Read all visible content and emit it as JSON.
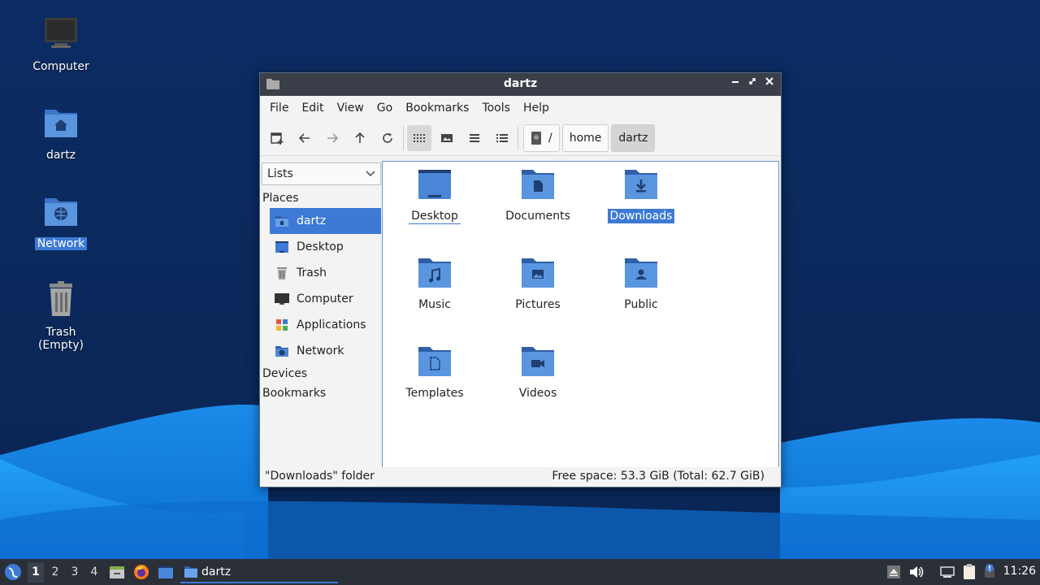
{
  "desktop": {
    "icons": [
      {
        "label": "Computer",
        "icon": "computer-icon"
      },
      {
        "label": "dartz",
        "icon": "home-folder-icon"
      },
      {
        "label": "Network",
        "icon": "network-folder-icon",
        "selected": true
      },
      {
        "label": "Trash (Empty)",
        "icon": "trash-icon"
      }
    ]
  },
  "window": {
    "title": "dartz",
    "menu": [
      "File",
      "Edit",
      "View",
      "Go",
      "Bookmarks",
      "Tools",
      "Help"
    ],
    "toolbar": {
      "buttons": [
        "new-tab-icon",
        "back-icon",
        "forward-icon",
        "up-icon",
        "reload-icon",
        "icon-view-icon",
        "thumbnail-view-icon",
        "compact-view-icon",
        "detailed-list-view-icon"
      ]
    },
    "breadcrumbs": [
      "/",
      "home",
      "dartz"
    ],
    "sidepane": {
      "mode": "Lists",
      "places_header": "Places",
      "places": [
        {
          "label": "dartz",
          "icon": "home-icon",
          "selected": true
        },
        {
          "label": "Desktop",
          "icon": "desktop-icon"
        },
        {
          "label": "Trash",
          "icon": "trash-icon"
        },
        {
          "label": "Computer",
          "icon": "computer-icon"
        },
        {
          "label": "Applications",
          "icon": "applications-icon"
        },
        {
          "label": "Network",
          "icon": "network-icon"
        }
      ],
      "devices_header": "Devices",
      "bookmarks_header": "Bookmarks"
    },
    "files": [
      {
        "label": "Desktop",
        "icon": "desktop-folder-icon"
      },
      {
        "label": "Documents",
        "icon": "documents-folder-icon"
      },
      {
        "label": "Downloads",
        "icon": "downloads-folder-icon",
        "selected": true
      },
      {
        "label": "Music",
        "icon": "music-folder-icon"
      },
      {
        "label": "Pictures",
        "icon": "pictures-folder-icon"
      },
      {
        "label": "Public",
        "icon": "public-folder-icon"
      },
      {
        "label": "Templates",
        "icon": "templates-folder-icon"
      },
      {
        "label": "Videos",
        "icon": "videos-folder-icon"
      }
    ],
    "status": {
      "left": "\"Downloads\" folder",
      "right": "Free space: 53.3 GiB (Total: 62.7 GiB)"
    }
  },
  "taskbar": {
    "workspaces": [
      "1",
      "2",
      "3",
      "4"
    ],
    "current_workspace": "1",
    "task_label": "dartz",
    "clock": "11:26"
  },
  "colors": {
    "accent": "#3d7ad6",
    "folder": "#4a86d8",
    "titlebar": "#3a3f4a",
    "taskbar": "#2a2f38"
  }
}
